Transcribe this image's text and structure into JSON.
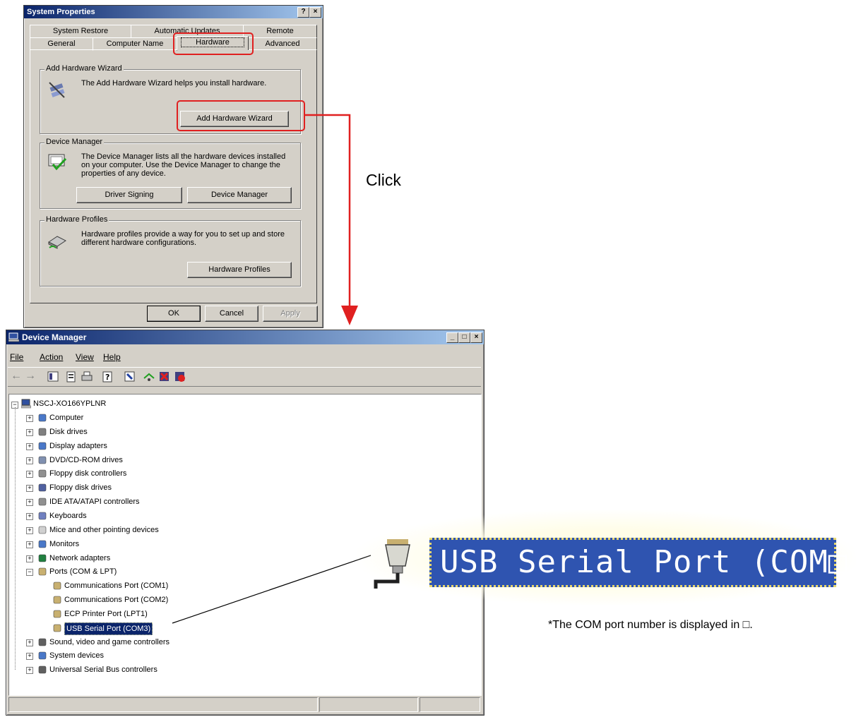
{
  "system_properties": {
    "title": "System Properties",
    "help_btn": "?",
    "close_btn": "×",
    "tabs_row1": [
      "System Restore",
      "Automatic Updates",
      "Remote"
    ],
    "tabs_row2": [
      "General",
      "Computer Name",
      "Hardware",
      "Advanced"
    ],
    "add_hw": {
      "group": "Add Hardware Wizard",
      "text": "The Add Hardware Wizard helps you install hardware.",
      "button": "Add Hardware Wizard"
    },
    "devmgr": {
      "group": "Device Manager",
      "text": "The Device Manager lists all the hardware devices installed on your computer. Use the Device Manager to change the properties of any device.",
      "btn_signing": "Driver Signing",
      "btn_devmgr": "Device Manager"
    },
    "profiles": {
      "group": "Hardware Profiles",
      "text": "Hardware profiles provide a way for you to set up and store different hardware configurations.",
      "button": "Hardware Profiles"
    },
    "ok": "OK",
    "cancel": "Cancel",
    "apply": "Apply"
  },
  "annotation": {
    "click": "Click",
    "zoom_label": "USB Serial Port (COM□)",
    "note": "*The COM port number is displayed in □."
  },
  "device_manager": {
    "title": "Device Manager",
    "min": "_",
    "max": "□",
    "close": "×",
    "menus": [
      "File",
      "Action",
      "View",
      "Help"
    ],
    "toolbar_icons": [
      "back-arrow-icon",
      "forward-arrow-icon",
      "show-hide-tree-icon",
      "properties-icon",
      "print-icon",
      "help-icon",
      "scan-hardware-icon",
      "update-driver-icon",
      "uninstall-icon",
      "disable-icon"
    ],
    "root": "NSCJ-XO166YPLNR",
    "tree": [
      {
        "label": "Computer",
        "expander": "+",
        "level": 1
      },
      {
        "label": "Disk drives",
        "expander": "+",
        "level": 1
      },
      {
        "label": "Display adapters",
        "expander": "+",
        "level": 1
      },
      {
        "label": "DVD/CD-ROM drives",
        "expander": "+",
        "level": 1
      },
      {
        "label": "Floppy disk controllers",
        "expander": "+",
        "level": 1
      },
      {
        "label": "Floppy disk drives",
        "expander": "+",
        "level": 1
      },
      {
        "label": "IDE ATA/ATAPI controllers",
        "expander": "+",
        "level": 1
      },
      {
        "label": "Keyboards",
        "expander": "+",
        "level": 1
      },
      {
        "label": "Mice and other pointing devices",
        "expander": "+",
        "level": 1
      },
      {
        "label": "Monitors",
        "expander": "+",
        "level": 1
      },
      {
        "label": "Network adapters",
        "expander": "+",
        "level": 1
      },
      {
        "label": "Ports (COM & LPT)",
        "expander": "−",
        "level": 1
      },
      {
        "label": "Communications Port (COM1)",
        "expander": "",
        "level": 2
      },
      {
        "label": "Communications Port (COM2)",
        "expander": "",
        "level": 2
      },
      {
        "label": "ECP Printer Port (LPT1)",
        "expander": "",
        "level": 2
      },
      {
        "label": "USB Serial Port (COM3)",
        "expander": "",
        "level": 2,
        "selected": true
      },
      {
        "label": "Sound, video and game controllers",
        "expander": "+",
        "level": 1
      },
      {
        "label": "System devices",
        "expander": "+",
        "level": 1
      },
      {
        "label": "Universal Serial Bus controllers",
        "expander": "+",
        "level": 1
      }
    ]
  },
  "colors": {
    "highlight": "#e02020",
    "selection": "#0a246a",
    "zoom_bg": "#2f54b0"
  }
}
